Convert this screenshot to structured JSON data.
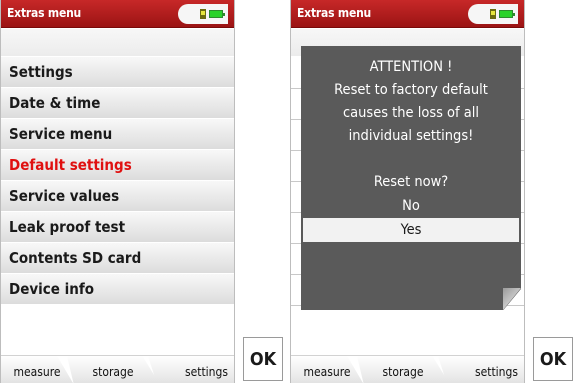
{
  "left": {
    "title": "Extras menu",
    "menu": [
      {
        "label": "Settings"
      },
      {
        "label": "Date & time"
      },
      {
        "label": "Service menu"
      },
      {
        "label": "Default settings"
      },
      {
        "label": "Service values"
      },
      {
        "label": "Leak proof test"
      },
      {
        "label": "Contents SD card"
      },
      {
        "label": "Device info"
      }
    ],
    "tabs": [
      "measure",
      "storage",
      "settings"
    ],
    "ok_label": "OK"
  },
  "right": {
    "title": "Extras menu",
    "dialog": {
      "line1": "ATTENTION !",
      "line2": "Reset to factory default",
      "line3": "causes the loss of all",
      "line4": "individual settings!",
      "question": "Reset now?",
      "options": [
        "No",
        "Yes"
      ],
      "selected_option": "Yes"
    },
    "tabs": [
      "measure",
      "storage",
      "settings"
    ],
    "ok_label": "OK"
  },
  "colors": {
    "title_bar": "#b01c1c",
    "active_item": "#e01010",
    "dialog_bg": "#5a5a5a",
    "battery": "#2bd22b",
    "sd_card": "#6b6b10"
  },
  "icons": [
    "sd-card-icon",
    "battery-icon"
  ]
}
